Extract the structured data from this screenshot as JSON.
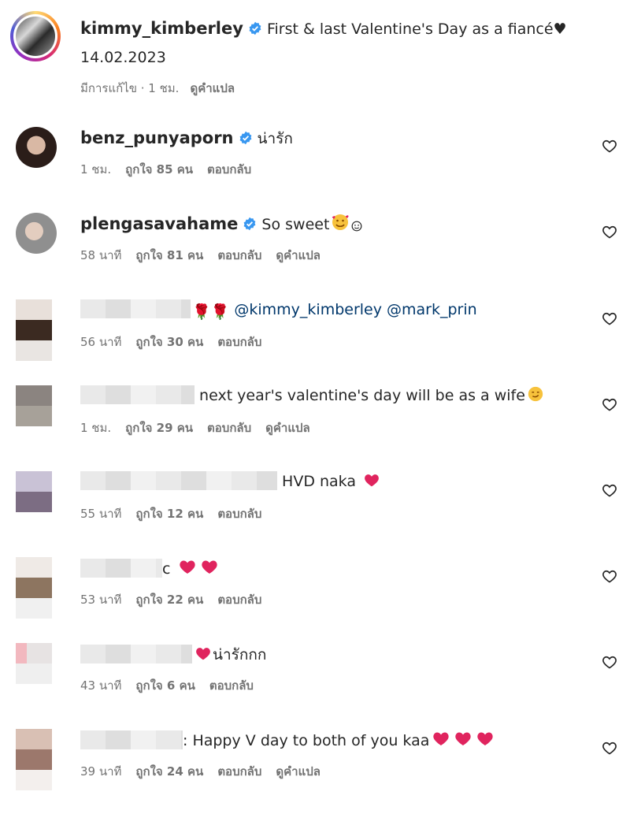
{
  "post": {
    "username": "kimmy_kimberley",
    "caption": "First & last Valentine's Day as a fiancé♥",
    "date_line": "14.02.2023",
    "meta_time": "มีการแก้ไข · 1 ชม.",
    "translate_label": "ดูคำแปล"
  },
  "comments": [
    {
      "username": "benz_punyaporn",
      "text": "น่ารัก",
      "time": "1 ชม.",
      "likes": "ถูกใจ 85 คน",
      "reply": "ตอบกลับ"
    },
    {
      "username": "plengasavahame",
      "text": "So sweet",
      "time": "58 นาที",
      "likes": "ถูกใจ 81 คน",
      "reply": "ตอบกลับ",
      "translate": "ดูคำแปล"
    },
    {
      "mention1": "@kimmy_kimberley",
      "mention2": "@mark_prin",
      "time": "56 นาที",
      "likes": "ถูกใจ 30 คน",
      "reply": "ตอบกลับ"
    },
    {
      "text": "next year's valentine's day will be as a wife",
      "time": "1 ชม.",
      "likes": "ถูกใจ 29 คน",
      "reply": "ตอบกลับ",
      "translate": "ดูคำแปล"
    },
    {
      "text": "HVD naka",
      "time": "55 นาที",
      "likes": "ถูกใจ 12 คน",
      "reply": "ตอบกลับ"
    },
    {
      "text": "c",
      "time": "53 นาที",
      "likes": "ถูกใจ 22 คน",
      "reply": "ตอบกลับ"
    },
    {
      "text": "น่ารักกก",
      "time": "43 นาที",
      "likes": "ถูกใจ 6 คน",
      "reply": "ตอบกลับ"
    },
    {
      "text": ": Happy V day to both of you kaa",
      "time": "39 นาที",
      "likes": "ถูกใจ 24 คน",
      "reply": "ตอบกลับ",
      "translate": "ดูคำแปล"
    }
  ],
  "colors": {
    "verified": "#3897f0",
    "mention": "#00376b",
    "meta": "#737373",
    "heart_emoji": "#e0245e"
  }
}
